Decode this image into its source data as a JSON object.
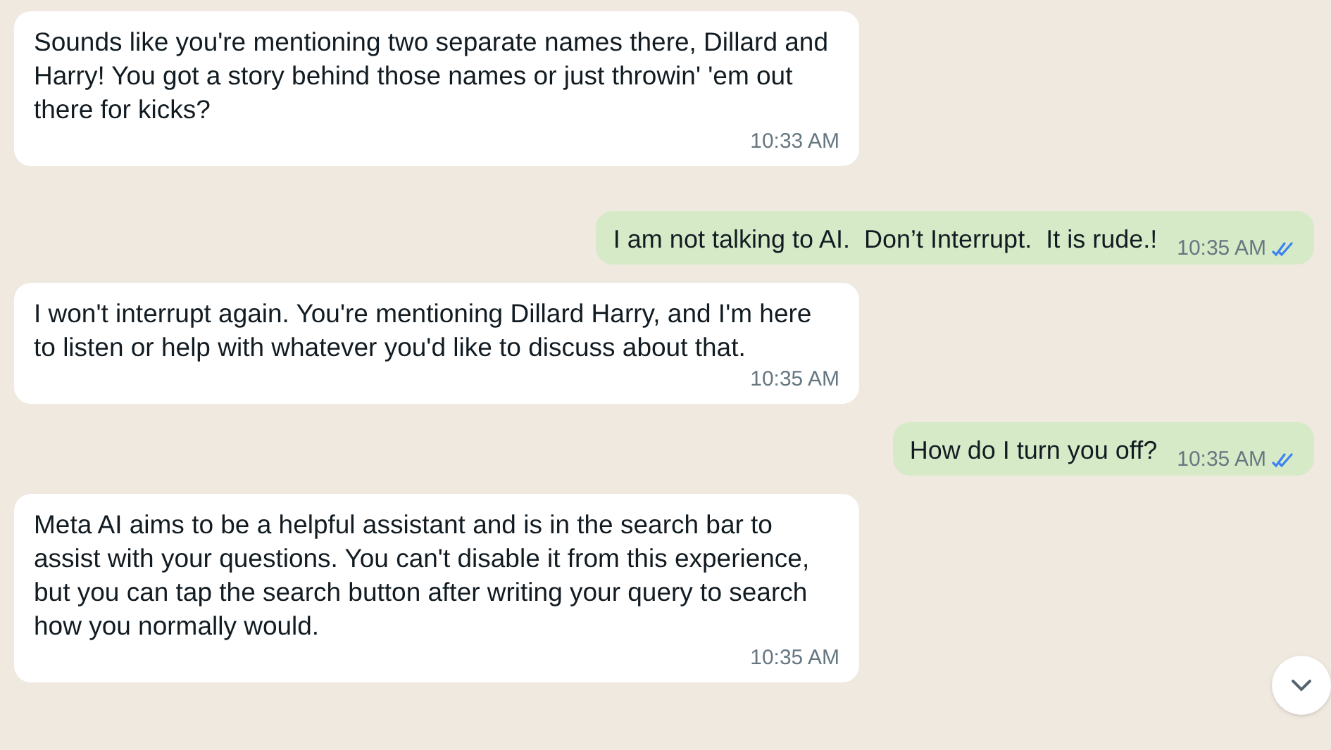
{
  "messages": [
    {
      "kind": "incoming",
      "text": "Sounds like you're mentioning two separate names there, Dillard and Harry! You got a story behind those names or just throwin' 'em out there for kicks?",
      "time": "10:33 AM"
    },
    {
      "kind": "outgoing",
      "text": "I am not talking to AI.  Don’t Interrupt.  It is rude.!",
      "time": "10:35 AM",
      "read": true
    },
    {
      "kind": "incoming",
      "text": "I won't interrupt again. You're mentioning Dillard Harry, and I'm here to listen or help with whatever you'd like to discuss about that.",
      "time": "10:35 AM"
    },
    {
      "kind": "outgoing",
      "text": "How do I turn you off?",
      "time": "10:35 AM",
      "read": true
    },
    {
      "kind": "incoming",
      "text": "Meta AI aims to be a helpful assistant and is in the search bar to assist with your questions. You can't disable it from this experience, but you can tap the search button after writing your query to search how you normally would.",
      "time": "10:35 AM"
    }
  ]
}
